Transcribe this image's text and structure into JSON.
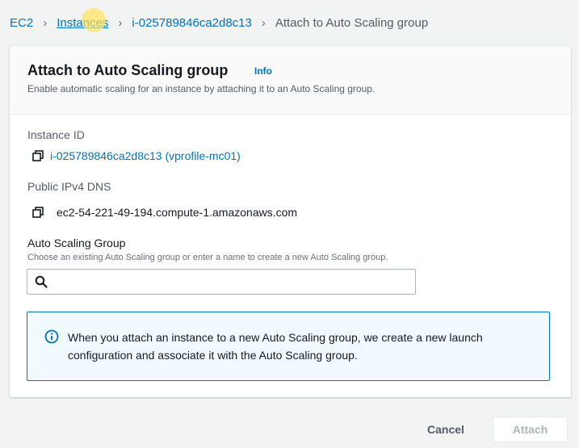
{
  "breadcrumb": {
    "items": [
      {
        "label": "EC2"
      },
      {
        "label": "Instances"
      },
      {
        "label": "i-025789846ca2d8c13"
      },
      {
        "label": "Attach to Auto Scaling group"
      }
    ]
  },
  "panel": {
    "title": "Attach to Auto Scaling group",
    "info_label": "Info",
    "description": "Enable automatic scaling for an instance by attaching it to an Auto Scaling group."
  },
  "instance": {
    "label": "Instance ID",
    "value": "i-025789846ca2d8c13 (vprofile-mc01)"
  },
  "dns": {
    "label": "Public IPv4 DNS",
    "value": "ec2-54-221-49-194.compute-1.amazonaws.com"
  },
  "asg": {
    "label": "Auto Scaling Group",
    "description": "Choose an existing Auto Scaling group or enter a name to create a new Auto Scaling group.",
    "value": "",
    "placeholder": ""
  },
  "alert": {
    "text": "When you attach an instance to a new Auto Scaling group, we create a new launch configuration and associate it with the Auto Scaling group."
  },
  "actions": {
    "cancel_label": "Cancel",
    "attach_label": "Attach"
  },
  "colors": {
    "link": "#0073bb",
    "alert_bg": "#f1faff",
    "alert_border": "#0073bb",
    "disabled_text": "#aab7b8"
  }
}
